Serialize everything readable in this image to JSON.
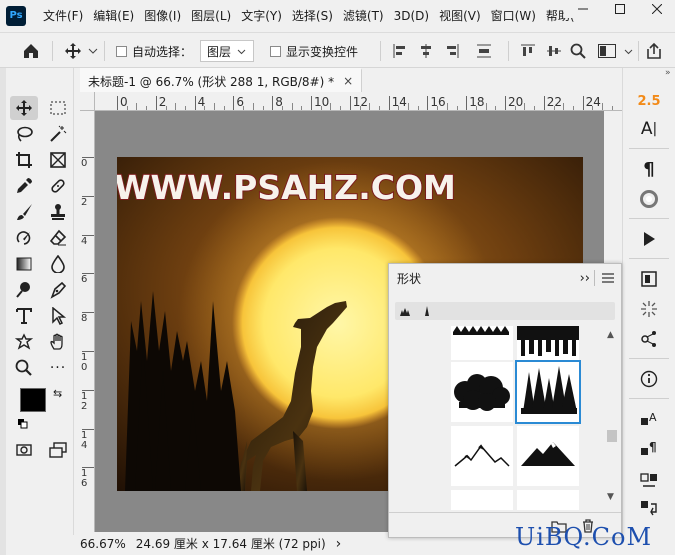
{
  "app": {
    "logo": "Ps"
  },
  "menus": [
    "文件(F)",
    "编辑(E)",
    "图像(I)",
    "图层(L)",
    "文字(Y)",
    "选择(S)",
    "滤镜(T)",
    "3D(D)",
    "视图(V)",
    "窗口(W)",
    "帮助("
  ],
  "window_controls": [
    "minimize",
    "maximize",
    "close"
  ],
  "options": {
    "auto_select_label": "自动选择：",
    "auto_select_value": "图层",
    "show_transform_label": "显示变换控件"
  },
  "document": {
    "tab_title": "未标题-1 @ 66.7% (形状 288 1, RGB/8#) *",
    "close_glyph": "×",
    "headline_text": "WWW.PSAHZ.COM"
  },
  "ruler_h": [
    "0",
    "2",
    "4",
    "6",
    "8",
    "10",
    "12",
    "14",
    "16",
    "18",
    "20",
    "22",
    "24"
  ],
  "ruler_v": [
    "0",
    "2",
    "4",
    "6",
    "8",
    "10",
    "12",
    "14",
    "16"
  ],
  "status": {
    "zoom": "66.67%",
    "doc_size": "24.69 厘米 x 17.64 厘米 (72 ppi)",
    "arrow": "›"
  },
  "shapes_panel": {
    "title": "形状",
    "expand_glyph": "››",
    "presets": [
      {
        "name": "trees-strip-shape"
      },
      {
        "name": "dark-forest-shape"
      },
      {
        "name": "bushes-shape"
      },
      {
        "name": "pine-trees-shape",
        "selected": true
      },
      {
        "name": "mountain-outline-shape"
      },
      {
        "name": "mountains-shape"
      }
    ]
  },
  "right_panel": {
    "value_label": "2.5",
    "text_glyph": "A",
    "para_glyph": "¶",
    "info_glyph": "i"
  },
  "colors": {
    "accent": "#f28a18",
    "selection": "#2a8ad4",
    "sun": "#ffe86a"
  },
  "watermark": "UiBQ.CoM"
}
